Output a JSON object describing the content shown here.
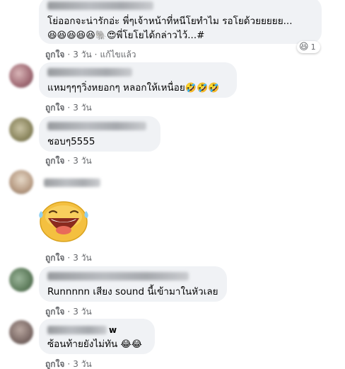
{
  "comments": [
    {
      "text_line1": "โย่ออกจะน่ารักอ่ะ พี่ๆเจ้าหน้าที่หนีโยทำไม รอโยด้วยยยยย...",
      "text_line2_emoji": "😆😆😆😆😆🐘😍",
      "text_line2": "พี่โยโยได้กล่าวไว้...#",
      "reaction_emoji": "😆",
      "reaction_count": "1",
      "like": "ถูกใจ",
      "time": "3 วัน",
      "edited": "แก้ไขแล้ว"
    },
    {
      "text": "แหมๆๆๆวิ่งหยอกๆ หลอกให้เหนื่อย",
      "emoji": "🤣🤣🤣",
      "like": "ถูกใจ",
      "time": "3 วัน"
    },
    {
      "text": "ชอบๆ5555",
      "like": "ถูกใจ",
      "time": "3 วัน"
    },
    {
      "like": "ถูกใจ",
      "time": "3 วัน"
    },
    {
      "text": "Runnnnn เสียง sound นี้เข้ามาในหัวเลย",
      "like": "ถูกใจ",
      "time": "3 วัน"
    },
    {
      "name_suffix": "w",
      "text": "ซ้อนท้ายยังไม่ทัน",
      "emoji": "😂😂",
      "like": "ถูกใจ",
      "time": "3 วัน"
    }
  ],
  "dot": "·",
  "colors": {
    "bubble": "#f0f2f5",
    "secondary_text": "#65676b",
    "sticker_face": "#f7c948"
  }
}
